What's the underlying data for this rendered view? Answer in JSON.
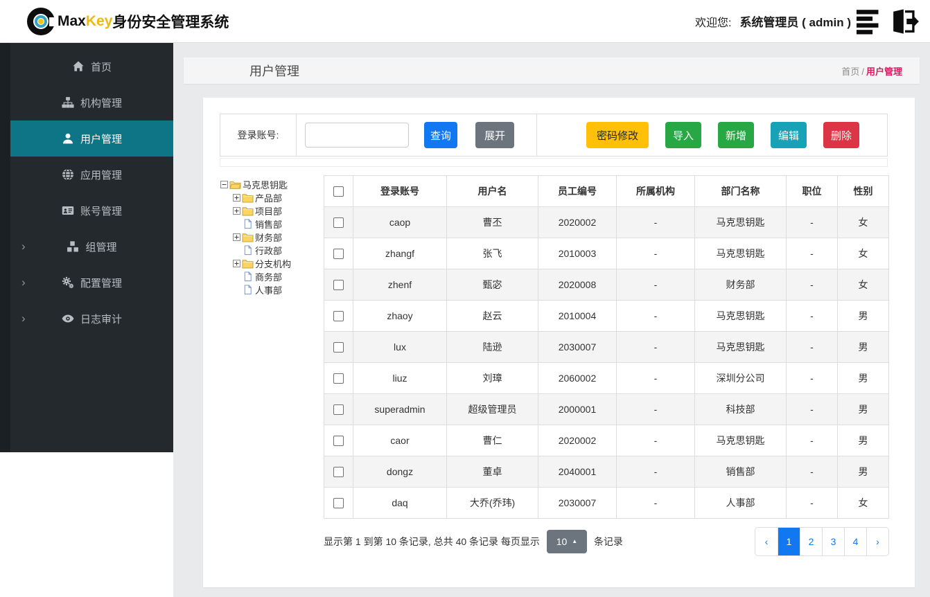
{
  "topnav": {
    "brand": {
      "max": "Max",
      "key": "Key",
      "suffix": "身份安全管理系统"
    },
    "welcome_label": "欢迎您:",
    "user": "系统管理员 ( admin )",
    "menu_icon": "list-icon",
    "logout_icon": "logout-icon"
  },
  "sidebar": {
    "items": [
      {
        "id": "home",
        "label": "首页",
        "icon": "home-icon",
        "active": false,
        "expandable": false
      },
      {
        "id": "org",
        "label": "机构管理",
        "icon": "sitemap-icon",
        "active": false,
        "expandable": false
      },
      {
        "id": "user",
        "label": "用户管理",
        "icon": "user-icon",
        "active": true,
        "expandable": false
      },
      {
        "id": "app",
        "label": "应用管理",
        "icon": "globe-icon",
        "active": false,
        "expandable": false
      },
      {
        "id": "account",
        "label": "账号管理",
        "icon": "id-card-icon",
        "active": false,
        "expandable": false
      },
      {
        "id": "group",
        "label": "组管理",
        "icon": "cubes-icon",
        "active": false,
        "expandable": true
      },
      {
        "id": "config",
        "label": "配置管理",
        "icon": "gears-icon",
        "active": false,
        "expandable": true
      },
      {
        "id": "audit",
        "label": "日志审计",
        "icon": "eye-icon",
        "active": false,
        "expandable": true
      }
    ]
  },
  "page": {
    "title": "用户管理",
    "breadcrumb": {
      "home": "首页",
      "sep": "/",
      "current": "用户管理"
    }
  },
  "search": {
    "label": "登录账号:",
    "input_value": "",
    "query_btn": "查询",
    "expand_btn": "展开"
  },
  "actions": {
    "password": "密码修改",
    "import": "导入",
    "add": "新增",
    "edit": "编辑",
    "delete": "删除"
  },
  "tree": {
    "root": "马克思钥匙",
    "children": [
      {
        "label": "产品部",
        "type": "folder"
      },
      {
        "label": "项目部",
        "type": "folder"
      },
      {
        "label": "销售部",
        "type": "leaf"
      },
      {
        "label": "财务部",
        "type": "folder"
      },
      {
        "label": "行政部",
        "type": "leaf"
      },
      {
        "label": "分支机构",
        "type": "folder"
      },
      {
        "label": "商务部",
        "type": "leaf"
      },
      {
        "label": "人事部",
        "type": "leaf"
      }
    ]
  },
  "table": {
    "columns": [
      "登录账号",
      "用户名",
      "员工编号",
      "所属机构",
      "部门名称",
      "职位",
      "性别"
    ],
    "rows": [
      [
        "caop",
        "曹丕",
        "2020002",
        "-",
        "马克思钥匙",
        "-",
        "女"
      ],
      [
        "zhangf",
        "张飞",
        "2010003",
        "-",
        "马克思钥匙",
        "-",
        "女"
      ],
      [
        "zhenf",
        "甄宓",
        "2020008",
        "-",
        "财务部",
        "-",
        "女"
      ],
      [
        "zhaoy",
        "赵云",
        "2010004",
        "-",
        "马克思钥匙",
        "-",
        "男"
      ],
      [
        "lux",
        "陆逊",
        "2030007",
        "-",
        "马克思钥匙",
        "-",
        "男"
      ],
      [
        "liuz",
        "刘璋",
        "2060002",
        "-",
        "深圳分公司",
        "-",
        "男"
      ],
      [
        "superadmin",
        "超级管理员",
        "2000001",
        "-",
        "科技部",
        "-",
        "男"
      ],
      [
        "caor",
        "曹仁",
        "2020002",
        "-",
        "马克思钥匙",
        "-",
        "男"
      ],
      [
        "dongz",
        "董卓",
        "2040001",
        "-",
        "销售部",
        "-",
        "男"
      ],
      [
        "daq",
        "大乔(乔玮)",
        "2030007",
        "-",
        "人事部",
        "-",
        "女"
      ]
    ]
  },
  "pagination": {
    "summary_prefix": "显示第 1 到第 10 条记录, 总共 40 条记录 每页显示",
    "page_size": "10",
    "summary_suffix": "条记录",
    "prev": "‹",
    "next": "›",
    "pages": [
      "1",
      "2",
      "3",
      "4"
    ],
    "active_page": "1"
  },
  "colors": {
    "sidebar_bg": "#24292d",
    "sidebar_edge": "#1b2024",
    "sidebar_active": "#0e7586",
    "brand_yellow": "#f0b90b",
    "primary": "#1178f2",
    "secondary": "#6c757d",
    "success": "#28a745",
    "info": "#17a2b8",
    "warning": "#ffc107",
    "danger": "#dc3545",
    "breadcrumb_active": "#d81b60",
    "pagination_active": "#1178f2",
    "page_bg": "#e9eaec",
    "titlebar_bg": "#f5f5f5",
    "table_stripe": "#f4f4f5",
    "table_border": "#dddddd"
  }
}
